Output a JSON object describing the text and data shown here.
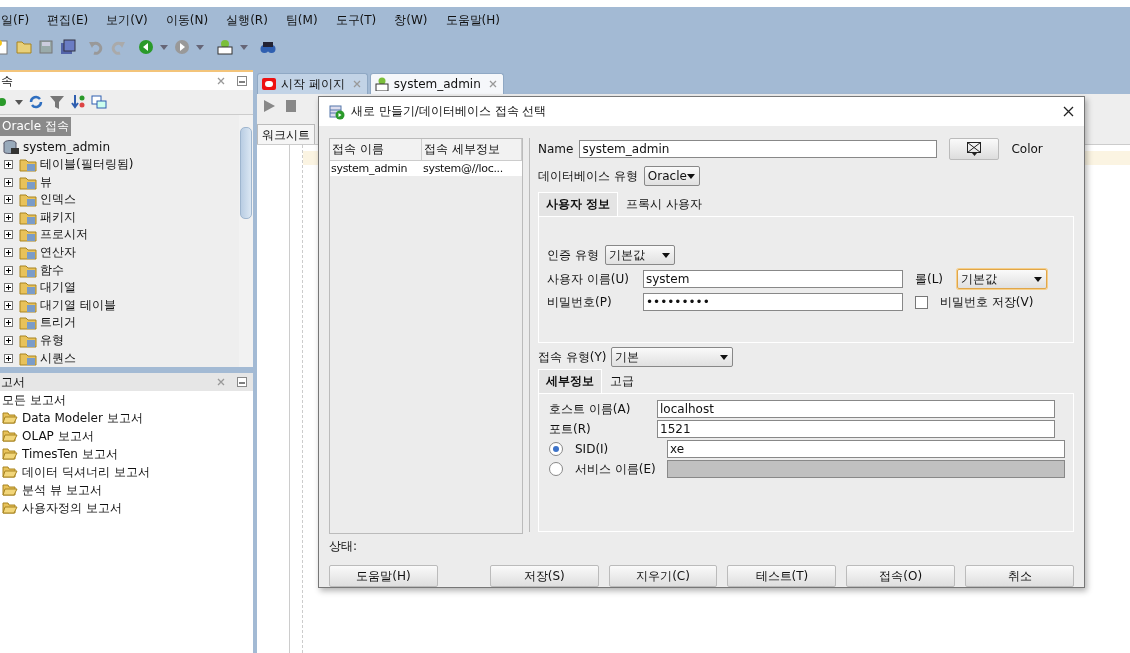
{
  "menu": [
    "일(F)",
    "편집(E)",
    "보기(V)",
    "이동(N)",
    "실행(R)",
    "팀(M)",
    "도구(T)",
    "창(W)",
    "도움말(H)"
  ],
  "connections_panel": {
    "title": "속",
    "root_label": "Oracle 접속",
    "connection": {
      "label": "system_admin",
      "children": [
        {
          "label": "테이블(필터링됨)",
          "expanded": false
        },
        {
          "label": "뷰",
          "expanded": false
        },
        {
          "label": "인덱스",
          "expanded": false
        },
        {
          "label": "패키지",
          "expanded": false
        },
        {
          "label": "프로시저",
          "expanded": false
        },
        {
          "label": "연산자",
          "expanded": false
        },
        {
          "label": "함수",
          "expanded": false
        },
        {
          "label": "대기열",
          "expanded": false
        },
        {
          "label": "대기열 테이블",
          "expanded": false
        },
        {
          "label": "트리거",
          "expanded": false
        },
        {
          "label": "유형",
          "expanded": false
        },
        {
          "label": "시퀀스",
          "expanded": false
        }
      ]
    }
  },
  "reports_panel": {
    "title": "고서",
    "root_label": "모든 보고서",
    "items": [
      "Data Modeler 보고서",
      "OLAP 보고서",
      "TimesTen 보고서",
      "데이터 딕셔너리 보고서",
      "분석 뷰 보고서",
      "사용자정의 보고서"
    ]
  },
  "editor_tabs": [
    {
      "label": "시작 페이지",
      "selected": false
    },
    {
      "label": "system_admin",
      "selected": true
    }
  ],
  "worksheet_tab": "워크시트",
  "dialog": {
    "title": "새로 만들기/데이터베이스 접속 선택",
    "table": {
      "columns": [
        "접속 이름",
        "접속 세부정보"
      ],
      "rows": [
        [
          "system_admin",
          "system@//loc..."
        ]
      ]
    },
    "name_label": "Name",
    "name_value": "system_admin",
    "color_label": "Color",
    "db_type_label": "데이터베이스 유형",
    "db_type_value": "Oracle",
    "user_tabs": [
      {
        "label": "사용자 정보",
        "selected": true
      },
      {
        "label": "프록시 사용자",
        "selected": false
      }
    ],
    "auth_type_label": "인증 유형",
    "auth_type_value": "기본값",
    "username_label": "사용자 이름(U)",
    "username_value": "system",
    "role_label": "롤(L)",
    "role_value": "기본값",
    "role_focused": true,
    "password_label": "비밀번호(P)",
    "password_value": "•••••••••",
    "save_password": {
      "label": "비밀번호 저장(V)",
      "checked": false
    },
    "conn_type_label": "접속 유형(Y)",
    "conn_type_value": "기본",
    "detail_tabs": [
      {
        "label": "세부정보",
        "selected": true
      },
      {
        "label": "고급",
        "selected": false
      }
    ],
    "host_label": "호스트 이름(A)",
    "host_value": "localhost",
    "port_label": "포트(R)",
    "port_value": "1521",
    "sid": {
      "label": "SID(I)",
      "selected": true,
      "value": "xe"
    },
    "service": {
      "label": "서비스 이름(E)",
      "selected": false
    },
    "status_label": "상태:",
    "buttons": [
      "도움말(H)",
      "저장(S)",
      "지우기(C)",
      "테스트(T)",
      "접속(O)",
      "취소"
    ]
  }
}
